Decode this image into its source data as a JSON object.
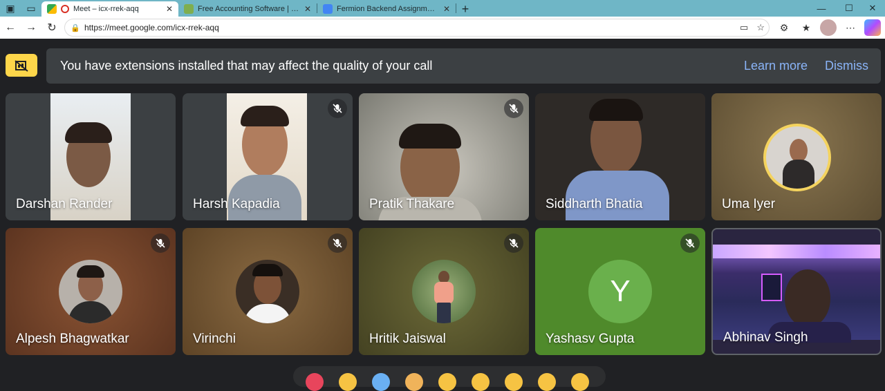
{
  "browser": {
    "tabs": [
      {
        "label": "Meet – icx-rrek-aqq",
        "active": true
      },
      {
        "label": "Free Accounting Software | GnuC",
        "active": false
      },
      {
        "label": "Fermion Backend Assignment - G",
        "active": false
      }
    ],
    "url": "https://meet.google.com/icx-rrek-aqq"
  },
  "banner": {
    "message": "You have extensions installed that may affect the quality of your call",
    "learn_more": "Learn more",
    "dismiss": "Dismiss"
  },
  "participants": [
    {
      "name": "Darshan Rander",
      "muted": false,
      "bg": "#3c4043"
    },
    {
      "name": "Harsh Kapadia",
      "muted": true,
      "bg": "#3c4043"
    },
    {
      "name": "Pratik Thakare",
      "muted": true,
      "bg": "#8b8d86"
    },
    {
      "name": "Siddharth Bhatia",
      "muted": false,
      "bg": "#2e2a27"
    },
    {
      "name": "Uma Iyer",
      "muted": false,
      "bg": "#6b5a3b"
    },
    {
      "name": "Alpesh Bhagwatkar",
      "muted": true,
      "bg": "#6a3e25"
    },
    {
      "name": "Virinchi",
      "muted": true,
      "bg": "#6d4e2c"
    },
    {
      "name": "Hritik Jaiswal",
      "muted": true,
      "bg": "#4a4a25"
    },
    {
      "name": "Yashasv Gupta",
      "muted": true,
      "bg": "#4f8a2b",
      "initial": "Y"
    },
    {
      "name": "Abhinav Singh",
      "muted": false,
      "bg": "#4a3b6e"
    }
  ],
  "colors": {
    "accent_link": "#8ab4f8",
    "banner_bg": "#3c4043",
    "page_bg": "#202124",
    "ext_warning": "#fdd64a"
  }
}
